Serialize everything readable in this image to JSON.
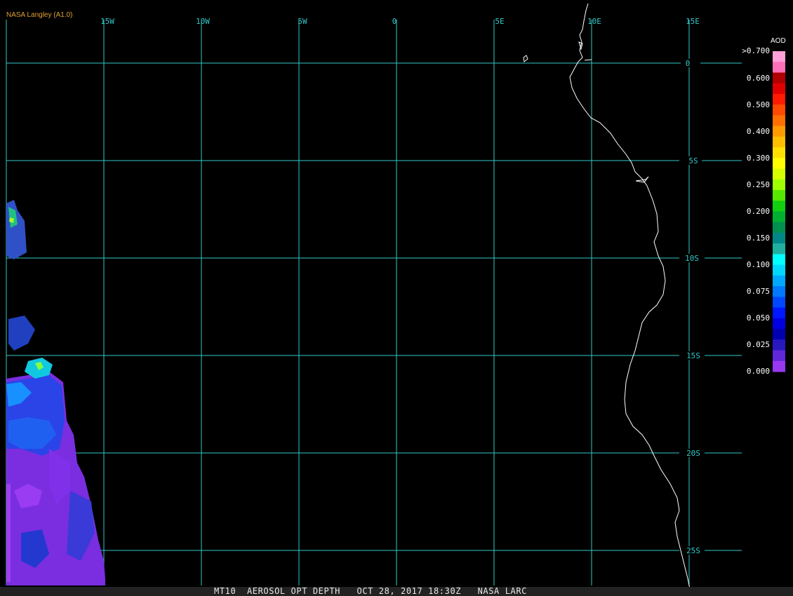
{
  "credit": "NASA Langley (A1.0)",
  "lon_labels": [
    "15W",
    "10W",
    "5W",
    "0",
    "5E",
    "10E",
    "15E"
  ],
  "lat_labels": [
    "0",
    "5S",
    "10S",
    "15S",
    "20S",
    "25S"
  ],
  "legend": {
    "title": "AOD",
    "labels": [
      ">0.700",
      "0.600",
      "0.500",
      "0.400",
      "0.300",
      "0.250",
      "0.200",
      "0.150",
      "0.100",
      "0.075",
      "0.050",
      "0.025",
      "0.000"
    ],
    "colors": [
      "#ffa0d8",
      "#ff70b8",
      "#b00000",
      "#e00000",
      "#ff1a00",
      "#ff4a00",
      "#ff7000",
      "#ff9a00",
      "#ffbe00",
      "#ffe000",
      "#ffff00",
      "#d8ff00",
      "#a0ff00",
      "#58e800",
      "#10d010",
      "#00b030",
      "#009050",
      "#008888",
      "#20b0a0",
      "#00ffff",
      "#00d8ff",
      "#00a8ff",
      "#0078ff",
      "#0048ff",
      "#0018ff",
      "#0000e0",
      "#0000b0",
      "#2818c0",
      "#6028d8",
      "#9838f0"
    ]
  },
  "bottom_caption": "MT10  AEROSOL OPT DEPTH   OCT 28, 2017 18:30Z   NASA LARC",
  "colors": {
    "grid": "#33c8c8",
    "coast": "#ffffff",
    "background": "#000000"
  }
}
